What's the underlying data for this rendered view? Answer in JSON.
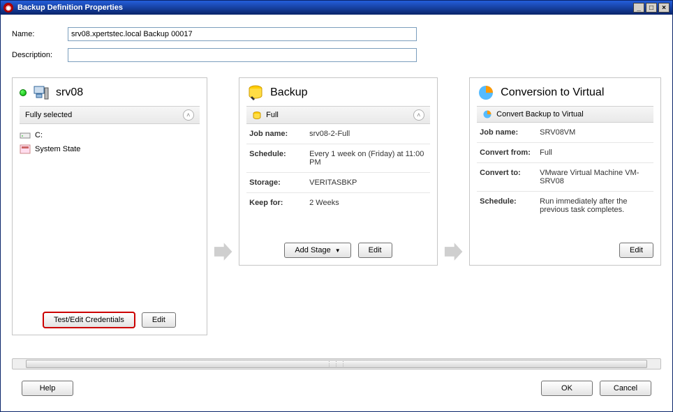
{
  "window": {
    "title": "Backup Definition Properties"
  },
  "form": {
    "name_label": "Name:",
    "name_value": "srv08.xpertstec.local Backup 00017",
    "description_label": "Description:",
    "description_value": ""
  },
  "panel_server": {
    "title": "srv08",
    "section_label": "Fully selected",
    "items": [
      {
        "label": "C:"
      },
      {
        "label": "System State"
      }
    ],
    "test_credentials_label": "Test/Edit Credentials",
    "edit_label": "Edit"
  },
  "panel_backup": {
    "title": "Backup",
    "section_label": "Full",
    "rows": {
      "jobname_label": "Job name:",
      "jobname_value": "srv08-2-Full",
      "schedule_label": "Schedule:",
      "schedule_value": "Every 1 week on (Friday) at 11:00 PM",
      "storage_label": "Storage:",
      "storage_value": "VERITASBKP",
      "keepfor_label": "Keep for:",
      "keepfor_value": "2 Weeks"
    },
    "add_stage_label": "Add Stage",
    "edit_label": "Edit"
  },
  "panel_convert": {
    "title": "Conversion to Virtual",
    "section_label": "Convert Backup to Virtual",
    "rows": {
      "jobname_label": "Job name:",
      "jobname_value": "SRV08VM",
      "convertfrom_label": "Convert from:",
      "convertfrom_value": "Full",
      "convertto_label": "Convert to:",
      "convertto_value": "VMware Virtual Machine VM-SRV08",
      "schedule_label": "Schedule:",
      "schedule_value": "Run immediately after the previous task completes."
    },
    "edit_label": "Edit"
  },
  "footer": {
    "help_label": "Help",
    "ok_label": "OK",
    "cancel_label": "Cancel"
  }
}
